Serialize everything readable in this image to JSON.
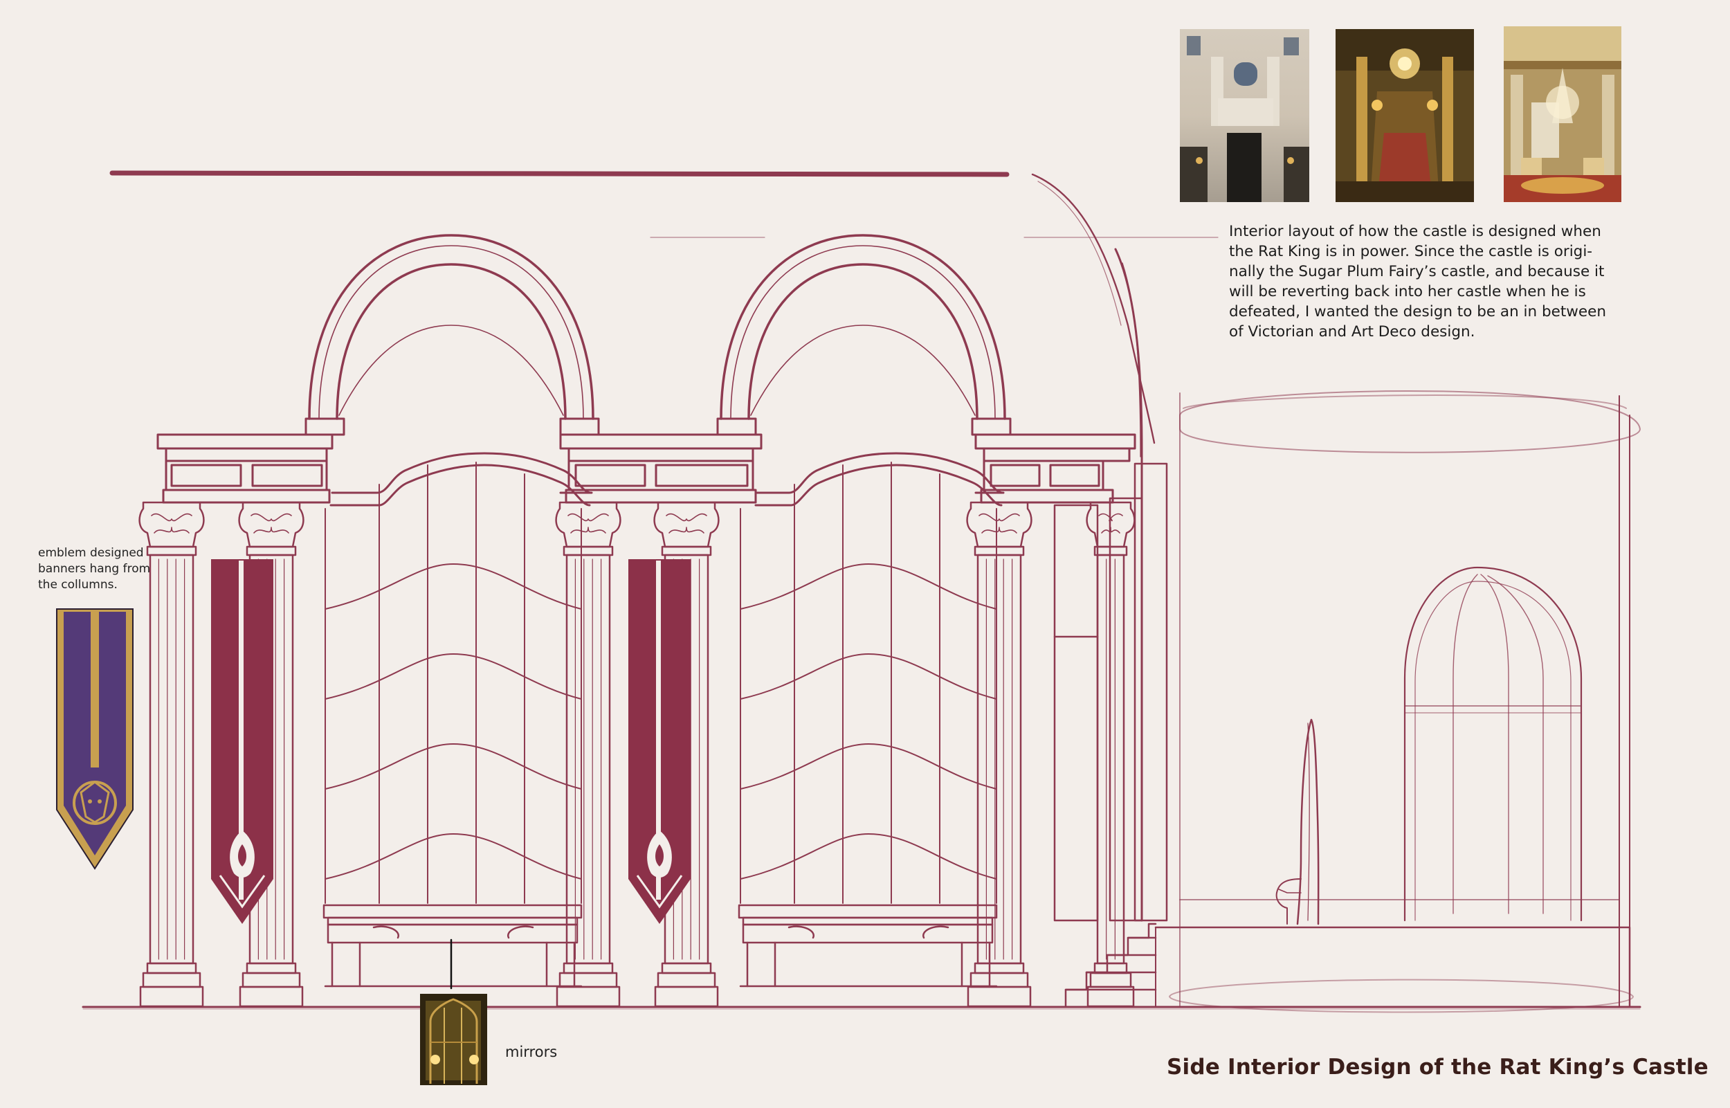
{
  "title": "Side Interior Design of the Rat King’s Castle",
  "description_lines": [
    "Interior layout of how the castle is designed when",
    "the Rat King is in power. Since the castle is origi-",
    "nally the Sugar Plum Fairy’s castle, and because it",
    "will be reverting back into her castle when he is",
    "defeated, I wanted the design to be an in between",
    "of Victorian and Art Deco design."
  ],
  "banner_note_lines": [
    "emblem designed",
    "banners hang from",
    "the collumns."
  ],
  "mirror_label": "mirrors",
  "colors": {
    "background": "#f3eeea",
    "line": "#8e3a50",
    "banner_red": "#8c3149",
    "banner_purple": "#543a78",
    "banner_gold": "#c8a050",
    "title": "#3a1e1a"
  },
  "reference_photos": [
    {
      "name": "art-deco-building-facade-photo"
    },
    {
      "name": "gilded-theater-lobby-photo"
    },
    {
      "name": "ornate-ballroom-chandelier-photo"
    },
    {
      "name": "mirror-reference-photo"
    }
  ]
}
